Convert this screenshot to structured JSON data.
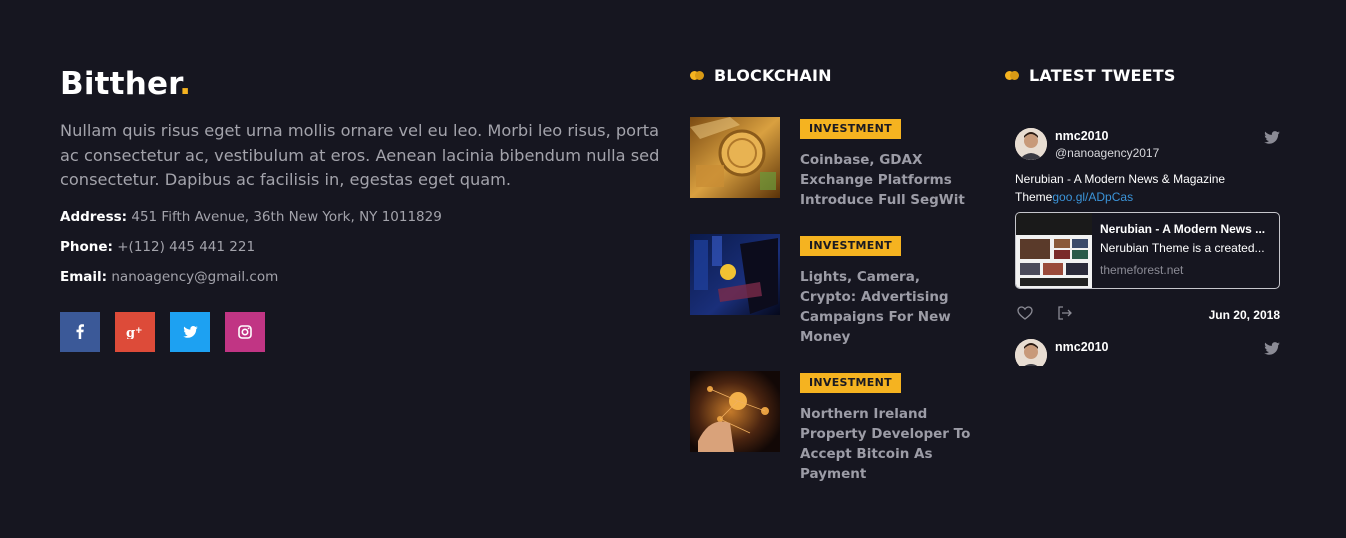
{
  "about": {
    "logo_text": "Bitther",
    "logo_dot": ".",
    "description": "Nullam quis risus eget urna mollis ornare vel eu leo. Morbi leo risus, porta ac consectetur ac, vestibulum at eros. Aenean lacinia bibendum nulla sed consectetur. Dapibus ac facilisis in, egestas eget quam.",
    "address_label": "Address:",
    "address_value": "451 Fifth Avenue, 36th New York, NY 1011829",
    "phone_label": "Phone:",
    "phone_value": "+(112) 445 441 221",
    "email_label": "Email:",
    "email_value": "nanoagency@gmail.com",
    "social": [
      {
        "name": "facebook",
        "icon": "facebook-icon",
        "color": "#3b5998"
      },
      {
        "name": "google-plus",
        "icon": "google-plus-icon",
        "color": "#dd4b39"
      },
      {
        "name": "twitter",
        "icon": "twitter-icon",
        "color": "#1da1f2"
      },
      {
        "name": "instagram",
        "icon": "instagram-icon",
        "color": "#c13584"
      }
    ]
  },
  "blockchain": {
    "heading": "BLOCKCHAIN",
    "posts": [
      {
        "category": "INVESTMENT",
        "title": "Coinbase, GDAX Exchange Platforms Introduce Full SegWit"
      },
      {
        "category": "INVESTMENT",
        "title": "Lights, Camera, Crypto: Advertising Campaigns For New Money"
      },
      {
        "category": "INVESTMENT",
        "title": "Northern Ireland Property Developer To Accept Bitcoin As Payment"
      }
    ]
  },
  "tweets": {
    "heading": "LATEST TWEETS",
    "items": [
      {
        "name": "nmc2010",
        "handle": "@nanoagency2017",
        "text": "Nerubian - A Modern News & Magazine Theme",
        "link": "goo.gl/ADpCas",
        "card_title": "Nerubian - A Modern News ...",
        "card_desc": "Nerubian Theme is a created...",
        "card_url": "themeforest.net",
        "date": "Jun 20, 2018"
      },
      {
        "name": "nmc2010"
      }
    ]
  },
  "colors": {
    "background": "#161620",
    "accent": "#f5b320",
    "link": "#3b94d9"
  }
}
